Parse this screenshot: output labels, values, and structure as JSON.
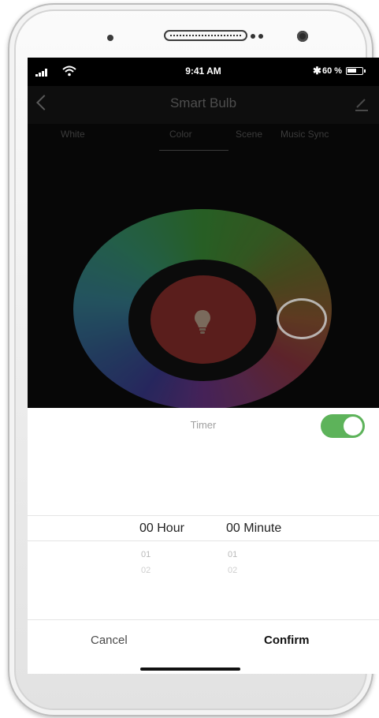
{
  "status_bar": {
    "time": "9:41 AM",
    "battery_percent": "60 %",
    "icons": [
      "signal-icon",
      "wifi-icon",
      "bluetooth-icon",
      "battery-icon"
    ]
  },
  "header": {
    "title": "Smart Bulb",
    "back_icon": "back-icon",
    "edit_icon": "edit-icon"
  },
  "tabs": [
    {
      "label": "White"
    },
    {
      "label": "Color"
    },
    {
      "label": "Scene"
    },
    {
      "label": "Music Sync"
    }
  ],
  "selected_tab": "Color",
  "color_wheel": {
    "center_color": "#5a1e1c",
    "icon": "bulb-icon"
  },
  "timer_sheet": {
    "title": "Timer",
    "toggle_on": true,
    "toggle_color": "#5db35a",
    "hour": {
      "selected": "00 Hour",
      "next": "01",
      "next2": "02"
    },
    "minute": {
      "selected": "00 Minute",
      "next": "01",
      "next2": "02"
    },
    "cancel_label": "Cancel",
    "confirm_label": "Confirm"
  }
}
